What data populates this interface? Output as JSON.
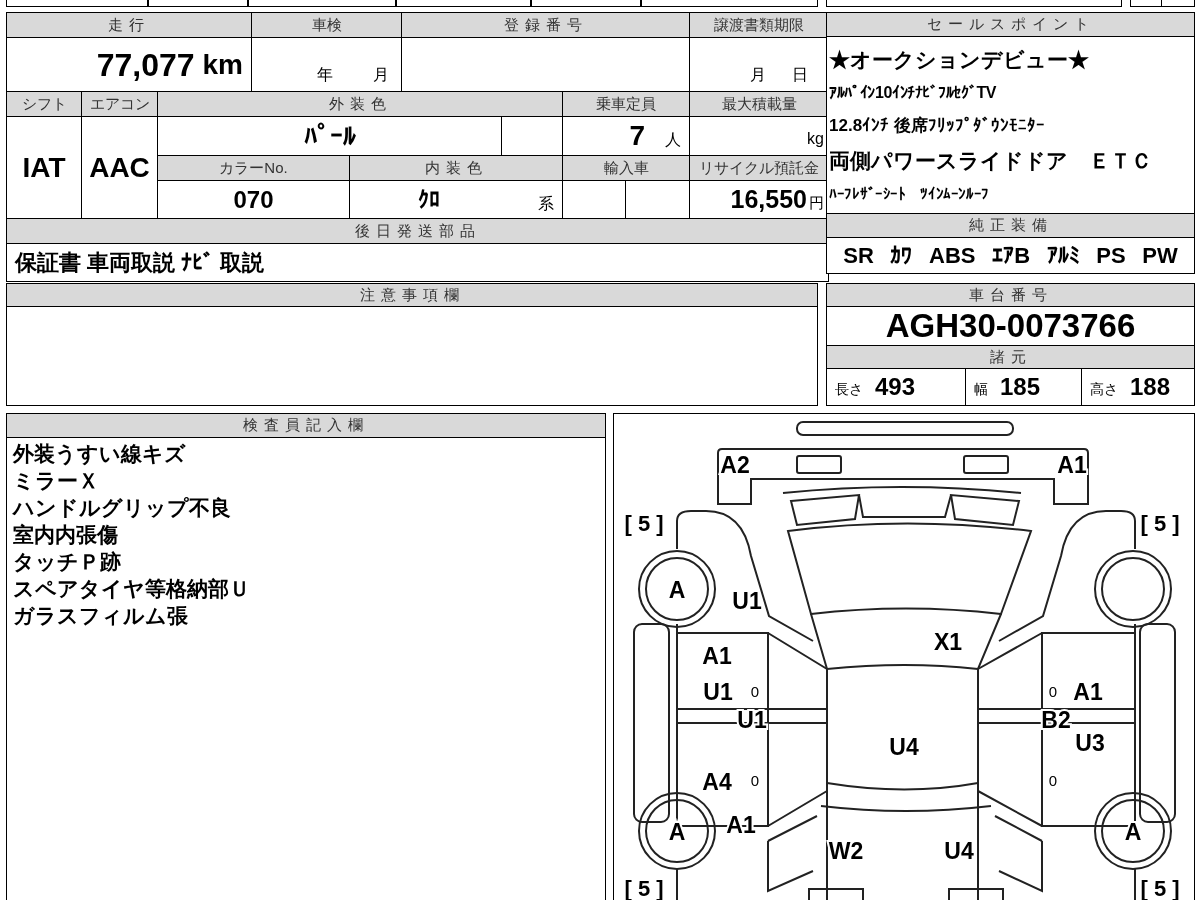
{
  "info": {
    "mileage_label": "走行",
    "mileage": "77,077",
    "mileage_unit": "km",
    "inspection_label": "車検",
    "inspection_year_unit": "年",
    "inspection_month_unit": "月",
    "registration_label": "登録番号",
    "transfer_deadline_label": "譲渡書類期限",
    "transfer_month_unit": "月",
    "transfer_day_unit": "日",
    "shift_label": "シフト",
    "shift": "IAT",
    "ac_label": "エアコン",
    "ac": "AAC",
    "exterior_color_label": "外装色",
    "exterior_color": "ﾊﾟｰﾙ",
    "capacity_label": "乗車定員",
    "capacity": "7",
    "capacity_unit": "人",
    "max_load_label": "最大積載量",
    "max_load_unit": "kg",
    "color_no_label": "カラーNo.",
    "color_no": "070",
    "interior_label": "内装色",
    "interior": "ｸﾛ",
    "interior_suffix": "系",
    "import_label": "輸入車",
    "recycle_label": "リサイクル預託金",
    "recycle_fee": "16,550",
    "recycle_unit": "円",
    "parts_label": "後日発送部品",
    "parts": "保証書 車両取説 ﾅﾋﾞ 取説"
  },
  "sales_points": {
    "label": "セールスポイント",
    "lines": [
      "★オークションデビュー★",
      "ｱﾙﾊﾟｲﾝ10ｲﾝﾁﾅﾋﾞﾌﾙｾｸﾞTV",
      "12.8ｲﾝﾁ 後席ﾌﾘｯﾌﾟﾀﾞｳﾝﾓﾆﾀｰ",
      "両側パワースライドドア　ＥＴＣ",
      "ﾊｰﾌﾚｻﾞｰｼｰﾄ　ﾂｲﾝﾑｰﾝﾙｰﾌ"
    ]
  },
  "equipment": {
    "label": "純正装備",
    "items": [
      "SR",
      "ｶﾜ",
      "ABS",
      "ｴｱB",
      "ｱﾙﾐ",
      "PS",
      "PW"
    ]
  },
  "notes": {
    "label": "注意事項欄"
  },
  "chassis": {
    "label": "車台番号",
    "number": "AGH30-0073766"
  },
  "specs": {
    "label": "諸元",
    "items": [
      {
        "label": "長さ",
        "value": "493"
      },
      {
        "label": "幅",
        "value": "185"
      },
      {
        "label": "高さ",
        "value": "188"
      }
    ]
  },
  "inspector": {
    "label": "検査員記入欄",
    "lines": [
      "外装うすい線キズ",
      "ミラーＸ",
      "ハンドルグリップ不良",
      "室内内張傷",
      "タッチＰ跡",
      "スペアタイヤ等格納部Ｕ",
      "ガラスフィルム張"
    ]
  },
  "diagram": {
    "marks": [
      "[ 5 ]",
      "[ 5 ]",
      "[ 5 ]",
      "[ 5 ]",
      "A2",
      "A1",
      "A",
      "U1",
      "X1",
      "A1",
      "U1",
      "0",
      "U1",
      "0",
      "A1",
      "B2",
      "U4",
      "U3",
      "A4",
      "0",
      "0",
      "A",
      "A1",
      "A",
      "W2",
      "U4"
    ]
  }
}
